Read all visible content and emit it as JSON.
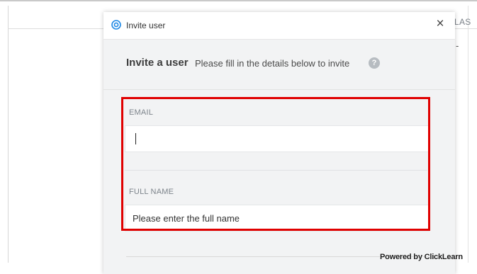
{
  "background": {
    "column_header": "LAS",
    "cell_value": "-"
  },
  "modal": {
    "title": "Invite user",
    "close_glyph": "×",
    "heading": "Invite a user",
    "subheading": "Please fill in the details below to invite",
    "help_glyph": "?",
    "icons": {
      "app": "target-icon",
      "close": "close-icon",
      "help": "help-icon"
    }
  },
  "form": {
    "email": {
      "label": "EMAIL",
      "value": "",
      "placeholder": ""
    },
    "full_name": {
      "label": "FULL NAME",
      "value": "",
      "placeholder": "Please enter the full name"
    }
  },
  "watermark": "Powered by ClickLearn",
  "colors": {
    "highlight": "#e00000",
    "app_icon": "#1e88e5",
    "help_icon_bg": "#b7bcc1"
  }
}
